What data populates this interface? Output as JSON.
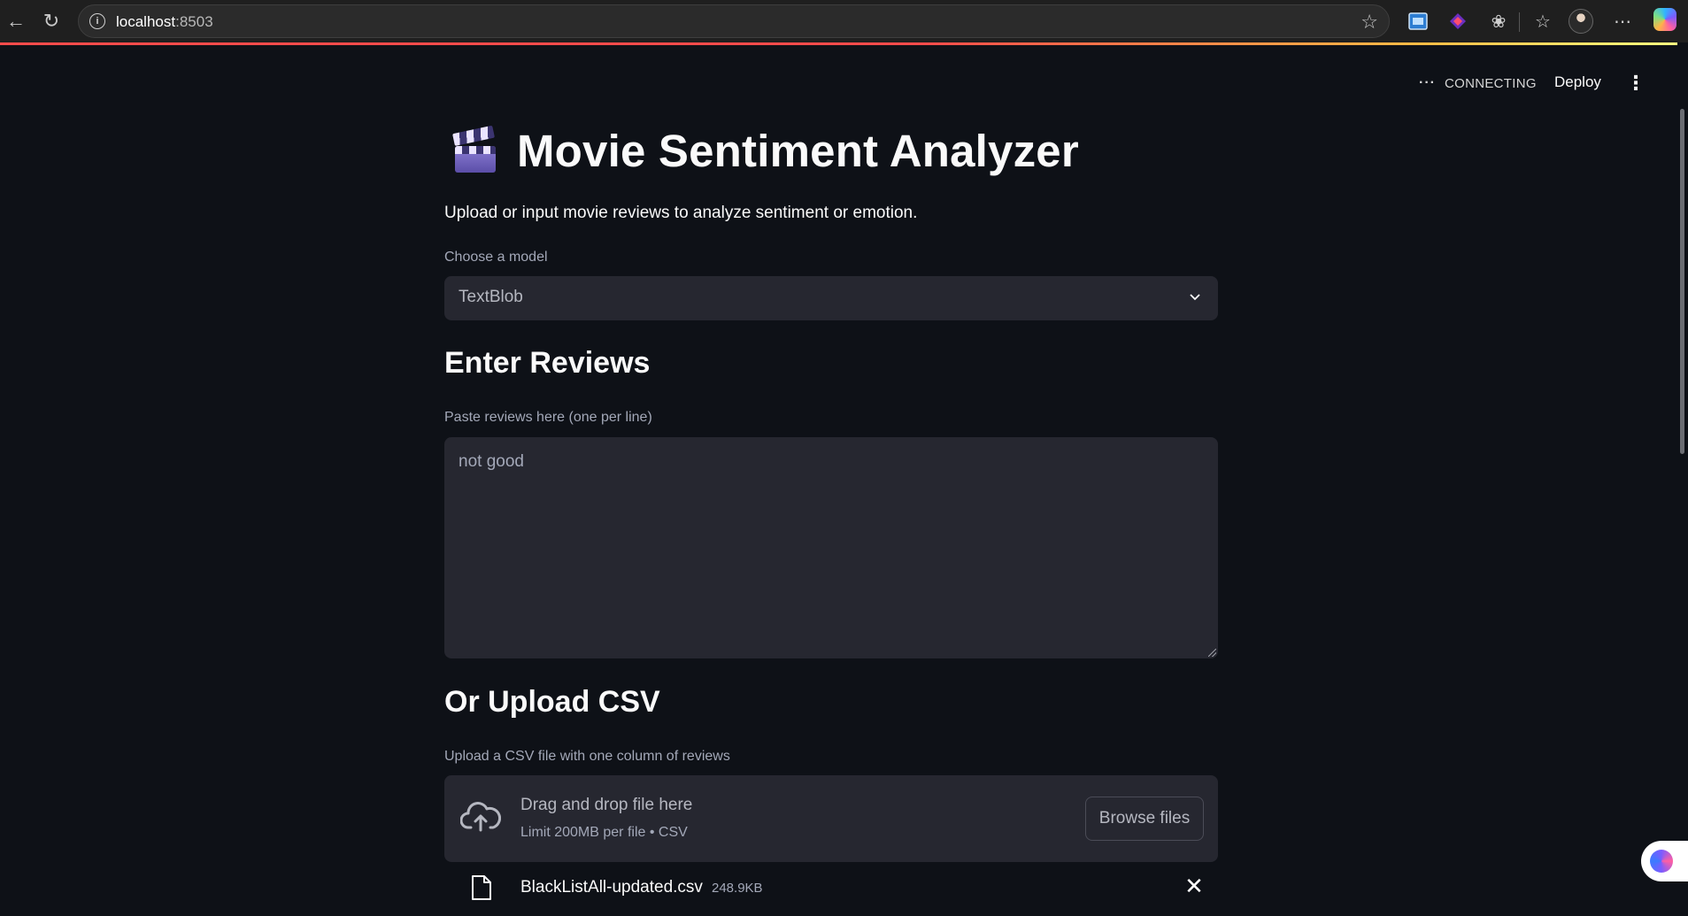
{
  "browser": {
    "url_host": "localhost",
    "url_port": ":8503"
  },
  "header": {
    "status_text": "CONNECTING",
    "deploy_label": "Deploy"
  },
  "main": {
    "title": "Movie Sentiment Analyzer",
    "subtitle": "Upload or input movie reviews to analyze sentiment or emotion.",
    "model_select": {
      "label": "Choose a model",
      "value": "TextBlob"
    },
    "reviews": {
      "heading": "Enter Reviews",
      "label": "Paste reviews here (one per line)",
      "value": "not good"
    },
    "upload": {
      "heading": "Or Upload CSV",
      "label": "Upload a CSV file with one column of reviews",
      "drop_title": "Drag and drop file here",
      "drop_limit": "Limit 200MB per file • CSV",
      "browse_label": "Browse files",
      "file_name": "BlackListAll-updated.csv",
      "file_size": "248.9KB"
    }
  },
  "colors": {
    "background": "#0e1117",
    "widget_bg": "#262730",
    "text": "#fafafa",
    "muted": "#a3a8b8",
    "accent_line": "#ff4b4b"
  },
  "icons": [
    "back-icon",
    "reload-icon",
    "info-icon",
    "star-icon",
    "extension-icon",
    "favorites-icon",
    "more-icon",
    "clapper-icon",
    "chevron-down-icon",
    "cloud-upload-icon",
    "file-icon",
    "close-icon"
  ]
}
